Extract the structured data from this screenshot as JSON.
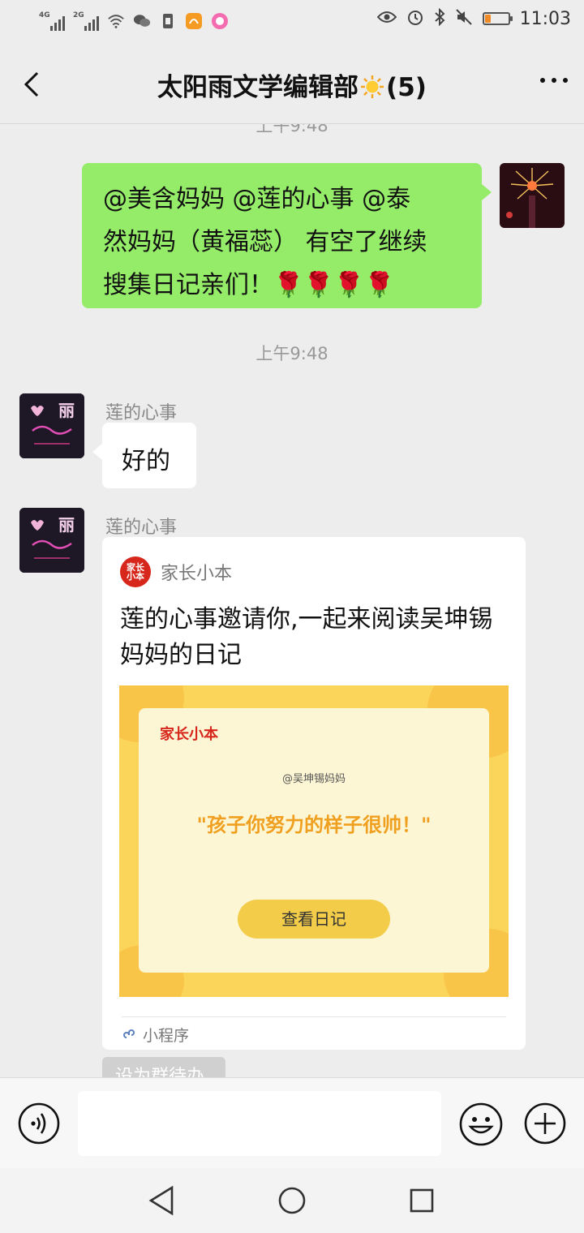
{
  "status_bar": {
    "network_1": "4G",
    "network_2": "2G",
    "time": "11:03",
    "battery_level": 0.25
  },
  "header": {
    "title": "太阳雨文学编辑部",
    "member_count": "(5)"
  },
  "chat": {
    "top_timestamp": "上午9:48",
    "messages": [
      {
        "from": "self",
        "text_lines": [
          "@美含妈妈 @莲的心事 @泰",
          "然妈妈（黄福蕊） 有空了继续",
          "搜集日记亲们！🌹🌹🌹🌹"
        ]
      },
      {
        "timestamp": "上午9:48"
      },
      {
        "from": "莲的心事",
        "text": "好的"
      },
      {
        "from": "莲的心事",
        "card": {
          "app_name": "家长小本",
          "title": "莲的心事邀请你,一起来阅读吴坤锡妈妈的日记",
          "image_logo": "家长小本",
          "image_handle": "@吴坤锡妈妈",
          "image_quote": "\"孩子你努力的样子很帅！\"",
          "image_button": "查看日记",
          "footer": "小程序"
        }
      }
    ],
    "partial_bubble_text": "设为群待办"
  },
  "input_bar": {
    "placeholder": ""
  },
  "colors": {
    "background": "#ededed",
    "self_bubble": "#95ec69",
    "card_image_bg": "#fbd45a",
    "quote": "#f0a020",
    "brand_red": "#d7261c"
  },
  "icons": [
    "back-icon",
    "more-icon",
    "sun-emoji-icon",
    "voice-icon",
    "emoji-icon",
    "plus-icon",
    "mini-program-icon",
    "nav-back-icon",
    "nav-home-icon",
    "nav-recent-icon"
  ]
}
